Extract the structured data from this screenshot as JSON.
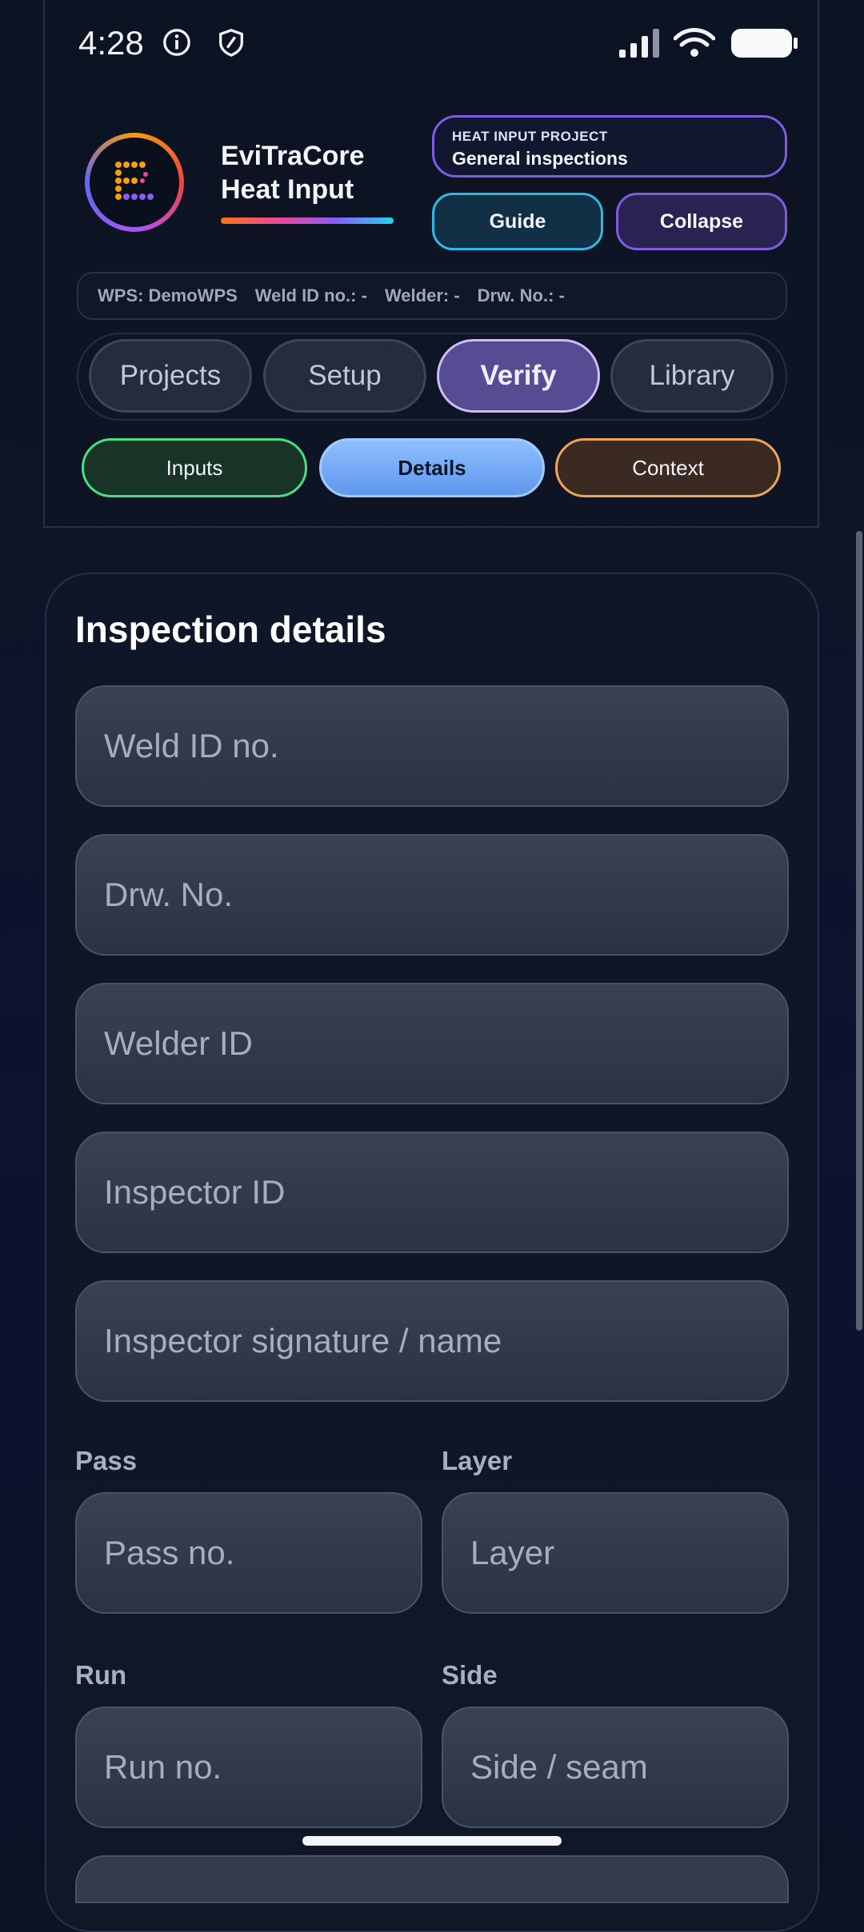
{
  "status_bar": {
    "time": "4:28"
  },
  "header": {
    "brand_line1": "EviTraCore",
    "brand_line2": "Heat Input",
    "project_label": "HEAT INPUT PROJECT",
    "project_name": "General inspections",
    "guide_label": "Guide",
    "collapse_label": "Collapse"
  },
  "meta": {
    "wps": "WPS: DemoWPS",
    "weld_id": "Weld ID no.: -",
    "welder": "Welder: -",
    "drw": "Drw. No.: -"
  },
  "tabs": [
    {
      "label": "Projects"
    },
    {
      "label": "Setup"
    },
    {
      "label": "Verify"
    },
    {
      "label": "Library"
    }
  ],
  "subtabs": [
    {
      "label": "Inputs"
    },
    {
      "label": "Details"
    },
    {
      "label": "Context"
    }
  ],
  "form": {
    "title": "Inspection details",
    "weld_id_placeholder": "Weld ID no.",
    "drw_placeholder": "Drw. No.",
    "welder_placeholder": "Welder ID",
    "inspector_placeholder": "Inspector ID",
    "signature_placeholder": "Inspector signature / name",
    "pass_label": "Pass",
    "pass_placeholder": "Pass no.",
    "layer_label": "Layer",
    "layer_placeholder": "Layer",
    "run_label": "Run",
    "run_placeholder": "Run no.",
    "side_label": "Side",
    "side_placeholder": "Side / seam"
  },
  "colors": {
    "inputs_accent": "#4ade80",
    "details_accent": "#8ec0ff",
    "context_accent": "#f0a35a",
    "verify_active": "#574c94"
  }
}
